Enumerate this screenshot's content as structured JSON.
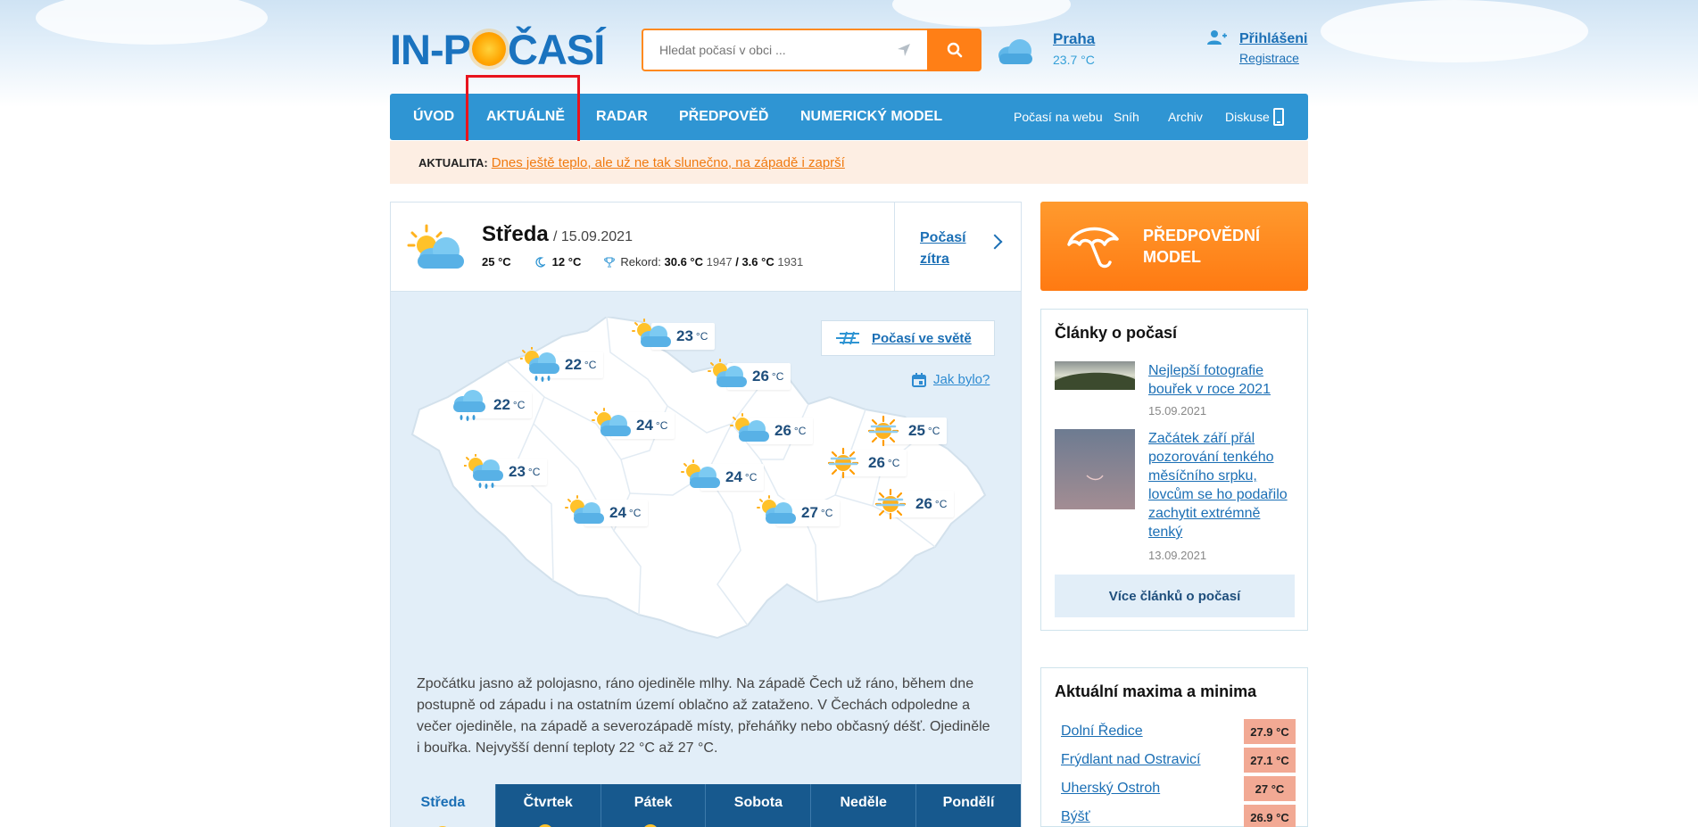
{
  "header": {
    "logo_part1": "IN-P",
    "logo_part2": "ČASÍ",
    "search_placeholder": "Hledat počasí v obci ...",
    "current_city": "Praha",
    "current_temp": "23.7 °C",
    "login": "Přihlášeni",
    "register": "Registrace"
  },
  "nav": {
    "items": [
      "ÚVOD",
      "AKTUÁLNĚ",
      "RADAR",
      "PŘEDPOVĚĎ",
      "NUMERICKÝ MODEL"
    ],
    "secondary": [
      "Počasí na webu",
      "Sníh",
      "Archiv",
      "Diskuse"
    ]
  },
  "news": {
    "label": "AKTUALITA:",
    "text": "Dnes ještě teplo, ale už ne tak slunečno, na západě i zaprší"
  },
  "day": {
    "name": "Středa",
    "date": "/ 15.09.2021",
    "max": "25 °C",
    "min": "12 °C",
    "record_label": "Rekord:",
    "record_max": "30.6 °C",
    "record_max_year": "1947",
    "record_sep": "/",
    "record_min": "3.6 °C",
    "record_min_year": "1931",
    "tomorrow": "Počasí zítra"
  },
  "map": {
    "world_link": "Počasí ve světě",
    "history_link": "Jak bylo?",
    "unit": "°C",
    "cities": [
      {
        "temp": "23",
        "icon": "partly-cloudy"
      },
      {
        "temp": "22",
        "icon": "sun-rain"
      },
      {
        "temp": "26",
        "icon": "partly-cloudy"
      },
      {
        "temp": "22",
        "icon": "rain"
      },
      {
        "temp": "24",
        "icon": "partly-cloudy"
      },
      {
        "temp": "26",
        "icon": "partly-cloudy"
      },
      {
        "temp": "25",
        "icon": "sun-fog"
      },
      {
        "temp": "23",
        "icon": "sun-rain"
      },
      {
        "temp": "24",
        "icon": "partly-cloudy"
      },
      {
        "temp": "26",
        "icon": "sun-fog"
      },
      {
        "temp": "24",
        "icon": "partly-cloudy"
      },
      {
        "temp": "27",
        "icon": "partly-cloudy"
      },
      {
        "temp": "26",
        "icon": "sun-fog"
      }
    ]
  },
  "description": "Zpočátku jasno až polojasno, ráno ojediněle mlhy. Na západě Čech už ráno, během dne postupně od západu i na ostatním území oblačno až zataženo. V Čechách odpoledne a večer ojediněle, na západě a severozápadě místy, přeháňky nebo občasný déšť. Ojediněle i bouřka. Nejvyšší denní teploty 22 °C až 27 °C.",
  "day_tabs": [
    "Středa",
    "Čtvrtek",
    "Pátek",
    "Sobota",
    "Neděle",
    "Pondělí"
  ],
  "sidebar": {
    "promo": "PŘEDPOVĚDNÍ MODEL",
    "articles_title": "Články o počasí",
    "articles": [
      {
        "title": "Nejlepší fotografie bouřek v roce 2021",
        "date": "15.09.2021"
      },
      {
        "title": "Začátek září přál pozorování tenkého měsíčního srpku, lovcům se ho podařilo zachytit extrémně tenký",
        "date": "13.09.2021"
      }
    ],
    "more_articles": "Více článků o počasí",
    "maxmin_title": "Aktuální maxima a minima",
    "maxmin": [
      {
        "name": "Dolní Ředice",
        "value": "27.9 °C"
      },
      {
        "name": "Frýdlant nad Ostravicí",
        "value": "27.1 °C"
      },
      {
        "name": "Uherský Ostroh",
        "value": "27 °C"
      },
      {
        "name": "Býšť",
        "value": "26.9 °C"
      }
    ]
  },
  "colors": {
    "brand_blue": "#2f95d3",
    "accent_orange": "#ff7f16",
    "highlight_red": "#e8141e"
  }
}
